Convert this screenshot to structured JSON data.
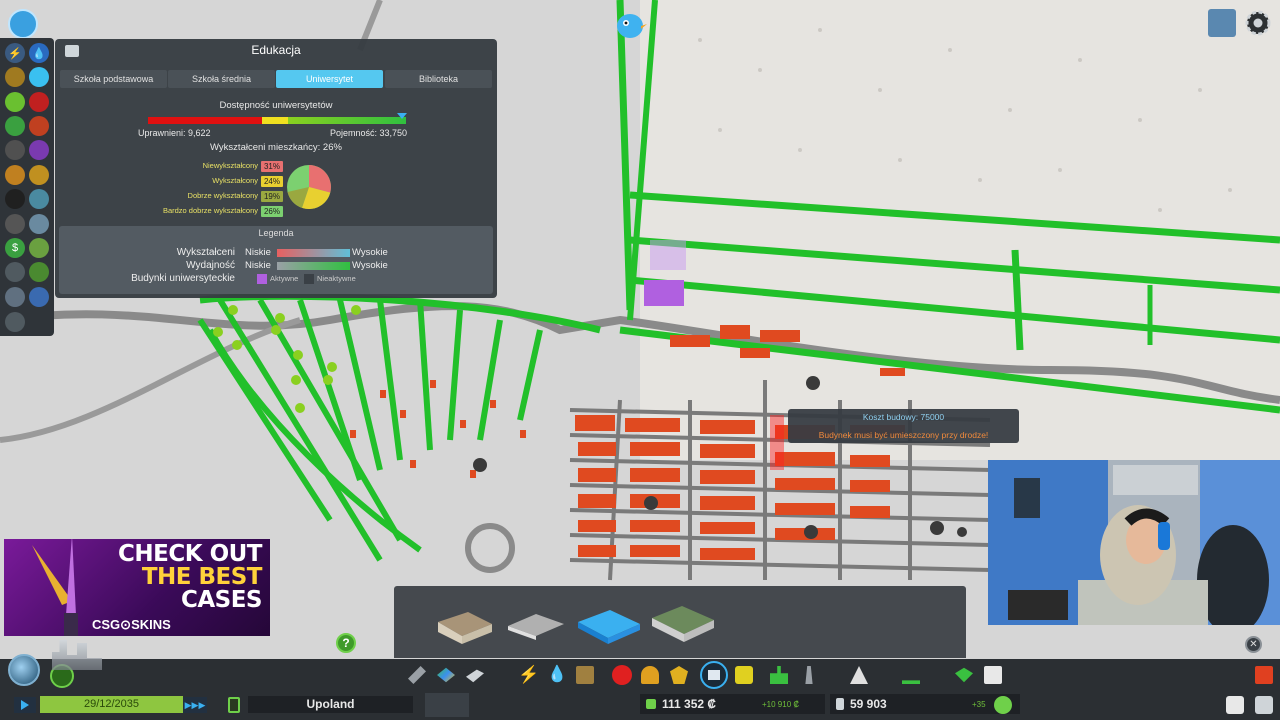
{
  "panel": {
    "title": "Edukacja",
    "tabs": [
      {
        "label": "Szkoła podstawowa",
        "active": false
      },
      {
        "label": "Szkoła średnia",
        "active": false
      },
      {
        "label": "Uniwersytet",
        "active": true
      },
      {
        "label": "Biblioteka",
        "active": false
      }
    ],
    "availability_title": "Dostępność uniwersytetów",
    "eligible": "Uprawnieni: 9,622",
    "capacity": "Pojemność: 33,750",
    "educated_residents": "Wykształceni mieszkańcy: 26%",
    "education_levels": [
      {
        "label": "Niewykształcony",
        "value": "31%",
        "color": "#e87070"
      },
      {
        "label": "Wykształcony",
        "value": "24%",
        "color": "#e8d030"
      },
      {
        "label": "Dobrze wykształcony",
        "value": "19%",
        "color": "#9aa840"
      },
      {
        "label": "Bardzo dobrze wykształcony",
        "value": "26%",
        "color": "#7cd070"
      }
    ],
    "legend": {
      "title": "Legenda",
      "educated_label": "Wykształceni",
      "efficiency_label": "Wydajność",
      "buildings_label": "Budynki uniwersyteckie",
      "low": "Niskie",
      "high": "Wysokie",
      "active": "Aktywne",
      "inactive": "Nieaktywne"
    }
  },
  "tooltip": {
    "cost": "Koszt budowy: 75000",
    "warning": "Budynek musi być umieszczony przy drodze!"
  },
  "ad": {
    "line1": "CHECK OUT",
    "line2": "THE BEST",
    "line3": "CASES",
    "brand": "CSG⊙SKINS"
  },
  "bottom": {
    "date": "29/12/2035",
    "city": "Upoland",
    "money": "111 352 ₡",
    "money_delta": "+10 910 ₡",
    "population": "59 903",
    "population_delta": "+35"
  },
  "colors": {
    "accent": "#55c8f0",
    "road_green": "#22c02a",
    "building_red": "#e04a20",
    "money_green": "#8ec640"
  },
  "icons": {
    "help": "question-icon",
    "close": "close-icon",
    "settings": "gear-icon",
    "chirper": "chirper-bird-icon"
  }
}
